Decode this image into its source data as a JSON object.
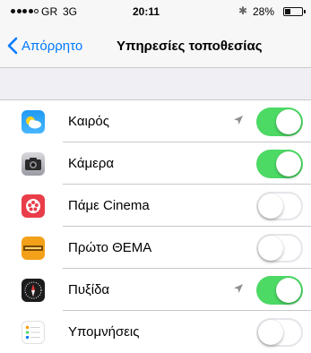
{
  "status_bar": {
    "carrier": "GR",
    "network": "3G",
    "time": "20:11",
    "battery_percent": "28%",
    "signal_bars": 4,
    "signal_total": 5
  },
  "nav": {
    "back_label": "Απόρρητο",
    "title": "Υπηρεσίες τοποθεσίας"
  },
  "colors": {
    "accent": "#007aff",
    "toggle_on": "#4cd964",
    "location_arrow": "#8e8e93"
  },
  "apps": [
    {
      "label": "Καιρός",
      "icon": "weather-icon",
      "location_recent": true,
      "enabled": true
    },
    {
      "label": "Κάμερα",
      "icon": "camera-icon",
      "location_recent": false,
      "enabled": true
    },
    {
      "label": "Πάμε Cinema",
      "icon": "cinema-icon",
      "location_recent": false,
      "enabled": false
    },
    {
      "label": "Πρώτο ΘΕΜΑ",
      "icon": "proto-thema-icon",
      "location_recent": false,
      "enabled": false
    },
    {
      "label": "Πυξίδα",
      "icon": "compass-icon",
      "location_recent": true,
      "enabled": true
    },
    {
      "label": "Υπομνήσεις",
      "icon": "reminders-icon",
      "location_recent": false,
      "enabled": false
    }
  ]
}
